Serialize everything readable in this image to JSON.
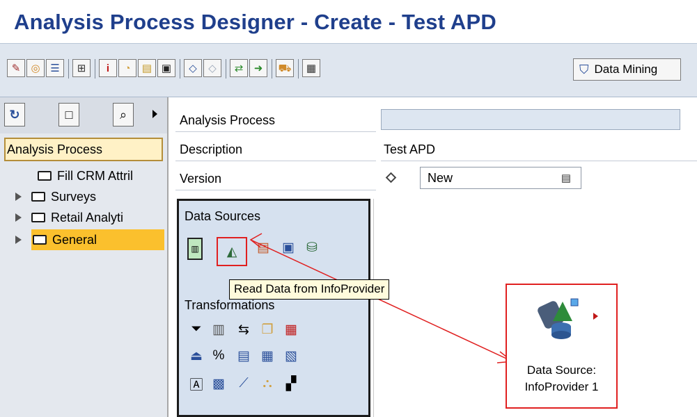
{
  "title": "Analysis Process Designer - Create - Test APD",
  "toolbar": {
    "data_mining_label": "Data Mining",
    "buttons": [
      {
        "icon": "magic-wand-icon"
      },
      {
        "icon": "objects-icon"
      },
      {
        "icon": "list-icon"
      },
      {
        "icon": "hierarchy-icon"
      },
      {
        "icon": "info-icon"
      },
      {
        "icon": "clock-icon"
      },
      {
        "icon": "tree-icon"
      },
      {
        "icon": "monitor-icon"
      },
      {
        "icon": "check-icon"
      },
      {
        "icon": "check-disabled-icon"
      },
      {
        "icon": "activate-icon"
      },
      {
        "icon": "execute-icon"
      },
      {
        "icon": "transport-icon"
      },
      {
        "icon": "table-icon"
      }
    ]
  },
  "nav": {
    "header": "Analysis Process",
    "tree": [
      {
        "label": "Fill CRM Attril",
        "expandable": false,
        "selected": false
      },
      {
        "label": "Surveys",
        "expandable": true,
        "selected": false
      },
      {
        "label": "Retail Analyti",
        "expandable": true,
        "selected": false
      },
      {
        "label": "General",
        "expandable": true,
        "selected": true
      }
    ]
  },
  "form": {
    "analysis_process_label": "Analysis Process",
    "analysis_process_value": "",
    "description_label": "Description",
    "description_value": "Test APD",
    "version_label": "Version",
    "version_value": "New"
  },
  "palette": {
    "data_sources_title": "Data Sources",
    "transformations_title": "Transformations"
  },
  "tooltip": "Read Data from InfoProvider",
  "node": {
    "label_line1": "Data Source:",
    "label_line2": "InfoProvider 1"
  },
  "colors": {
    "title": "#1f3f8c",
    "highlight_red": "#e02020",
    "selected_folder_bg": "#fbc02d",
    "palette_bg": "#d6e1ef"
  }
}
